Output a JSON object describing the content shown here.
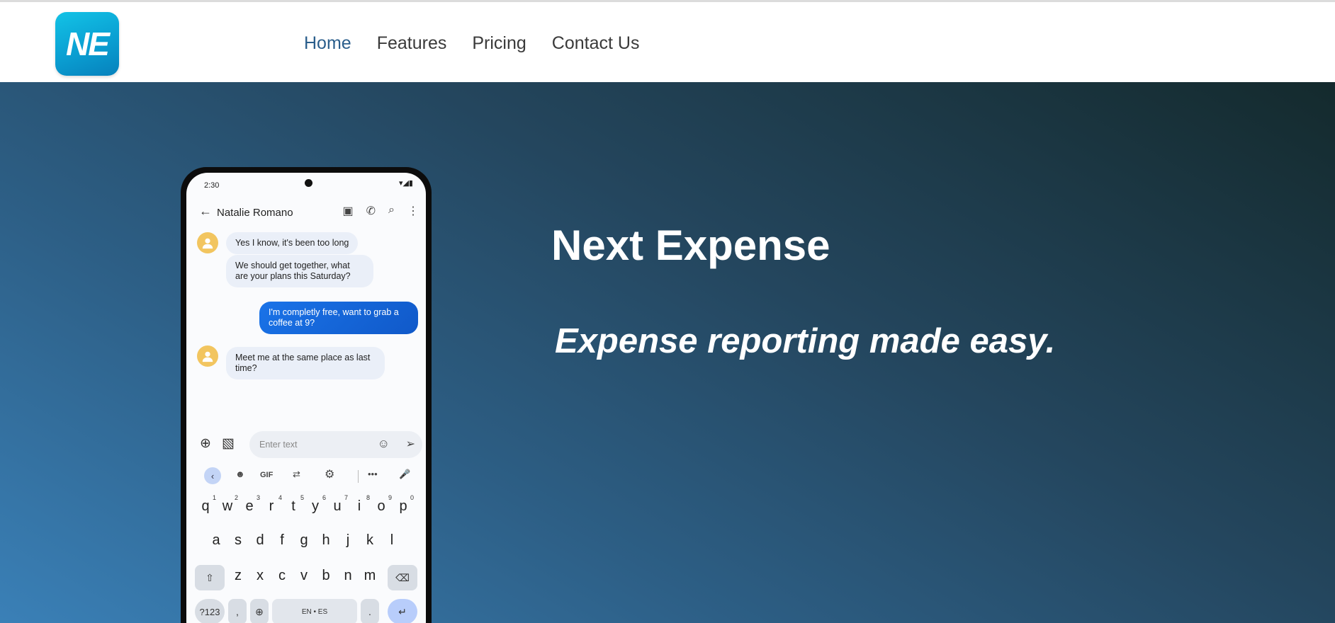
{
  "brand": {
    "logo_text": "NE",
    "accent": "#0a9fd2"
  },
  "nav": [
    {
      "label": "Home",
      "active": true
    },
    {
      "label": "Features",
      "active": false
    },
    {
      "label": "Pricing",
      "active": false
    },
    {
      "label": "Contact Us",
      "active": false
    }
  ],
  "hero": {
    "title": "Next Expense",
    "subtitle": "Expense reporting made easy."
  },
  "phone": {
    "time": "2:30",
    "status_icons": "▾◢▮",
    "contact": "Natalie Romano",
    "messages": [
      {
        "text": "Yes I know, it's been too long",
        "from": "them"
      },
      {
        "text": "We should get together, what are your plans this Saturday?",
        "from": "them"
      },
      {
        "text": "I'm completly free, want to grab a coffee at 9?",
        "from": "me"
      },
      {
        "text": "Meet me at the same place as last time?",
        "from": "them"
      }
    ],
    "input_placeholder": "Enter text",
    "keyboard": {
      "toolbar_gif": "GIF",
      "row1": [
        "q",
        "w",
        "e",
        "r",
        "t",
        "y",
        "u",
        "i",
        "o",
        "p"
      ],
      "row1_nums": [
        "1",
        "2",
        "3",
        "4",
        "5",
        "6",
        "7",
        "8",
        "9",
        "0"
      ],
      "row2": [
        "a",
        "s",
        "d",
        "f",
        "g",
        "h",
        "j",
        "k",
        "l"
      ],
      "row3": [
        "z",
        "x",
        "c",
        "v",
        "b",
        "n",
        "m"
      ],
      "sym_label": "?123",
      "comma": ",",
      "space_label": "EN • ES",
      "period": "."
    }
  }
}
